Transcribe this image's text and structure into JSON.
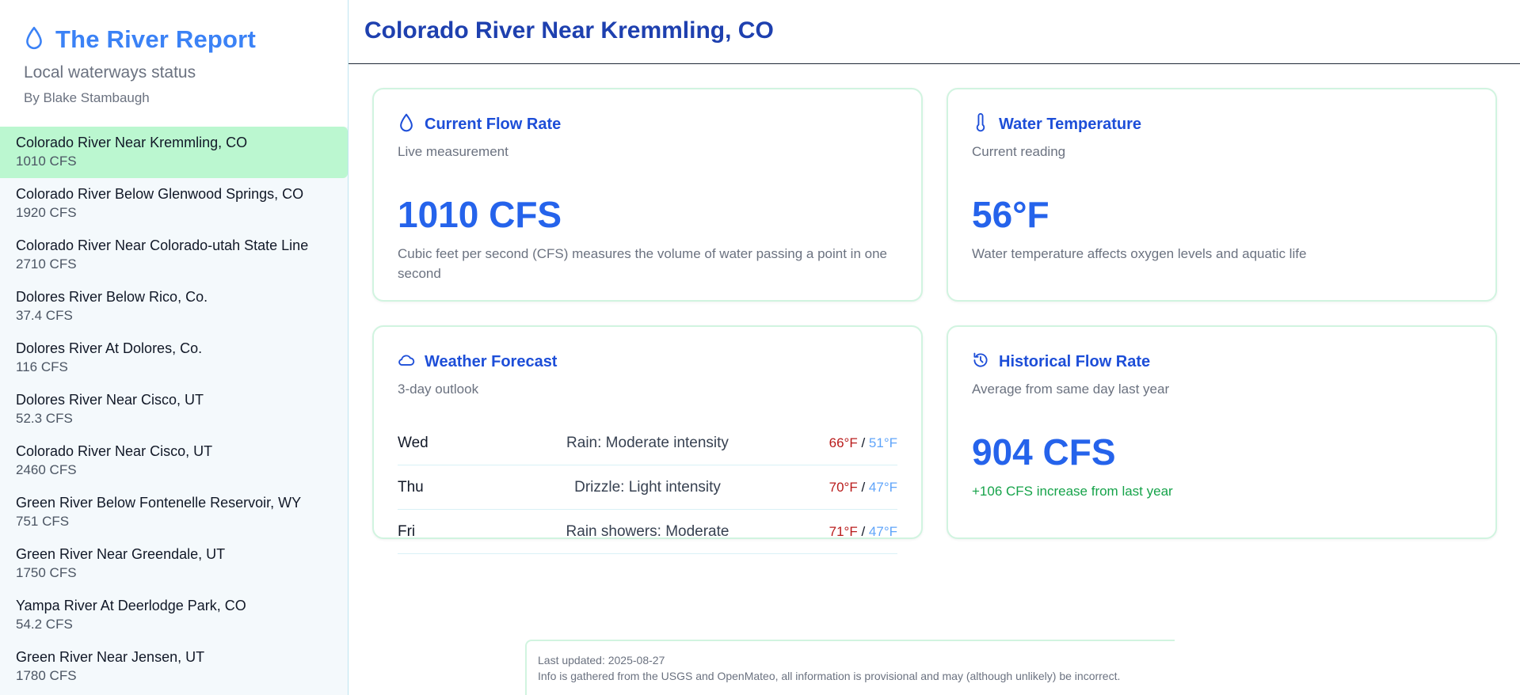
{
  "brand": {
    "name": "The River Report",
    "subtitle": "Local waterways status",
    "author": "By Blake Stambaugh",
    "icon": "droplet-icon",
    "accent": "#3b82f6"
  },
  "rivers": [
    {
      "name": "Colorado River Near Kremmling, CO",
      "flow": "1010 CFS",
      "active": true
    },
    {
      "name": "Colorado River Below Glenwood Springs, CO",
      "flow": "1920 CFS"
    },
    {
      "name": "Colorado River Near Colorado-utah State Line",
      "flow": "2710 CFS"
    },
    {
      "name": "Dolores River Below Rico, Co.",
      "flow": "37.4 CFS"
    },
    {
      "name": "Dolores River At Dolores, Co.",
      "flow": "116 CFS"
    },
    {
      "name": "Dolores River Near Cisco, UT",
      "flow": "52.3 CFS"
    },
    {
      "name": "Colorado River Near Cisco, UT",
      "flow": "2460 CFS"
    },
    {
      "name": "Green River Below Fontenelle Reservoir, WY",
      "flow": "751 CFS"
    },
    {
      "name": "Green River Near Greendale, UT",
      "flow": "1750 CFS"
    },
    {
      "name": "Yampa River At Deerlodge Park, CO",
      "flow": "54.2 CFS"
    },
    {
      "name": "Green River Near Jensen, UT",
      "flow": "1780 CFS"
    }
  ],
  "main": {
    "title": "Colorado River Near Kremmling, CO"
  },
  "cards": {
    "flow": {
      "title": "Current Flow Rate",
      "subtitle": "Live measurement",
      "value": "1010 CFS",
      "description": "Cubic feet per second (CFS) measures the volume of water passing a point in one second",
      "icon": "droplet-icon"
    },
    "temp": {
      "title": "Water Temperature",
      "subtitle": "Current reading",
      "value": "56°F",
      "description": "Water temperature affects oxygen levels and aquatic life",
      "icon": "thermometer-icon"
    },
    "weather": {
      "title": "Weather Forecast",
      "subtitle": "3-day outlook",
      "icon": "cloud-icon",
      "days": [
        {
          "day": "Wed",
          "desc": "Rain: Moderate intensity",
          "high": "66°F",
          "sep": "/",
          "low": "51°F"
        },
        {
          "day": "Thu",
          "desc": "Drizzle: Light intensity",
          "high": "70°F",
          "sep": "/",
          "low": "47°F"
        },
        {
          "day": "Fri",
          "desc": "Rain showers: Moderate",
          "high": "71°F",
          "sep": "/",
          "low": "47°F"
        }
      ]
    },
    "history": {
      "title": "Historical Flow Rate",
      "subtitle": "Average from same day last year",
      "value": "904 CFS",
      "change": "+106 CFS increase from last year",
      "icon": "history-icon"
    }
  },
  "footer": {
    "updated": "Last updated: 2025-08-27",
    "disclaimer": "Info is gathered from the USGS and OpenMateo, all information is provisional and may (although unlikely) be incorrect."
  },
  "colors": {
    "active_item": "#bbf7d0",
    "title": "#1e40af",
    "value": "#2563eb",
    "high_temp": "#b91c1c",
    "low_temp": "#60a5fa",
    "increase": "#16a34a"
  }
}
